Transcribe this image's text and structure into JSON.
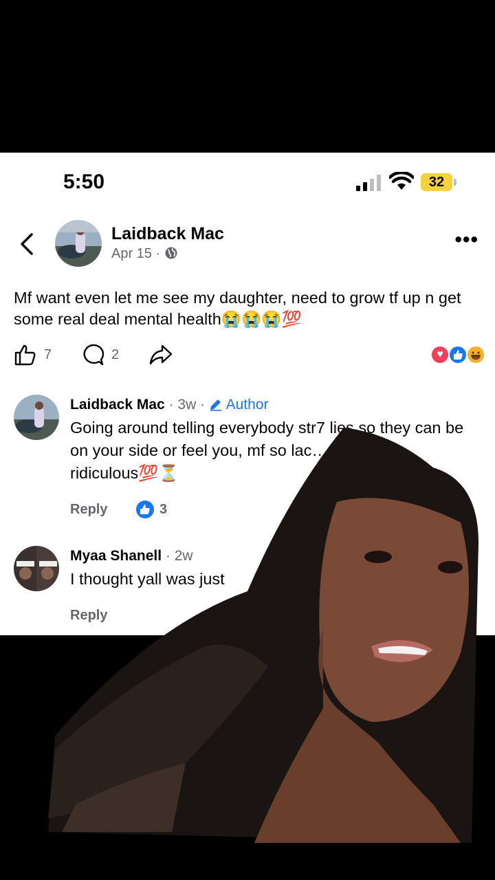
{
  "status_bar": {
    "time": "5:50",
    "battery": "32"
  },
  "post": {
    "author": "Laidback Mac",
    "date": "Apr 15",
    "meta_sep": " · ",
    "text": "Mf want even let me see my daughter, need to grow tf up n get some real deal mental health😭😭😭💯",
    "likes": "7",
    "comments": "2",
    "reactions": [
      "love",
      "like",
      "haha"
    ]
  },
  "comments": [
    {
      "name": "Laidback Mac",
      "sep": " · ",
      "time": "3w",
      "badge": "Author",
      "text": "Going around telling everybody str7 lies so they can be on your side or feel you, mf so lac… …ere it’s ridiculous💯⏳",
      "reply_label": "Reply",
      "likes": "3"
    },
    {
      "name": "Myaa Shanell",
      "sep": " · ",
      "time": "2w",
      "text": "I thought yall was just",
      "reply_label": "Reply"
    }
  ],
  "colors": {
    "accent": "#1877f2",
    "muted": "#65676b",
    "battery": "#f5d23a"
  }
}
